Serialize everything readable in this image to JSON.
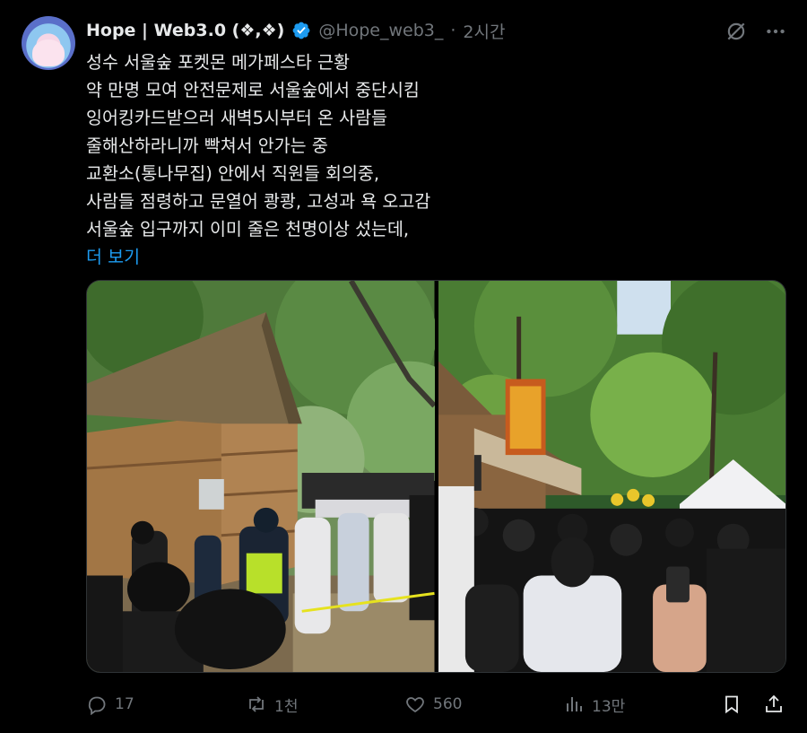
{
  "tweet": {
    "display_name": "Hope | Web3.0 (❖,❖)",
    "handle": "@Hope_web3_",
    "dot": "·",
    "time": "2시간",
    "lines": [
      "성수 서울숲 포켓몬 메가페스타 근황",
      "약 만명 모여 안전문제로 서울숲에서 중단시킴",
      "잉어킹카드받으러 새벽5시부터 온 사람들",
      "줄해산하라니까 빡쳐서 안가는 중",
      "교환소(통나무집) 안에서 직원들 회의중,",
      "사람들 점령하고 문열어 쾅쾅, 고성과 욕 오고감",
      "서울숲 입구까지 이미 줄은 천명이상 섰는데,"
    ],
    "show_more": "더 보기"
  },
  "actions": {
    "replies": "17",
    "reposts": "1천",
    "likes": "560",
    "views": "13만"
  },
  "colors": {
    "background": "#000000",
    "text": "#e7e9ea",
    "secondary": "#71767b",
    "link": "#1d9bf0",
    "verified": "#1d9bf0"
  },
  "icons": [
    "verified-badge-icon",
    "grok-icon",
    "more-icon",
    "reply-icon",
    "repost-icon",
    "like-icon",
    "views-icon",
    "bookmark-icon",
    "share-icon"
  ]
}
